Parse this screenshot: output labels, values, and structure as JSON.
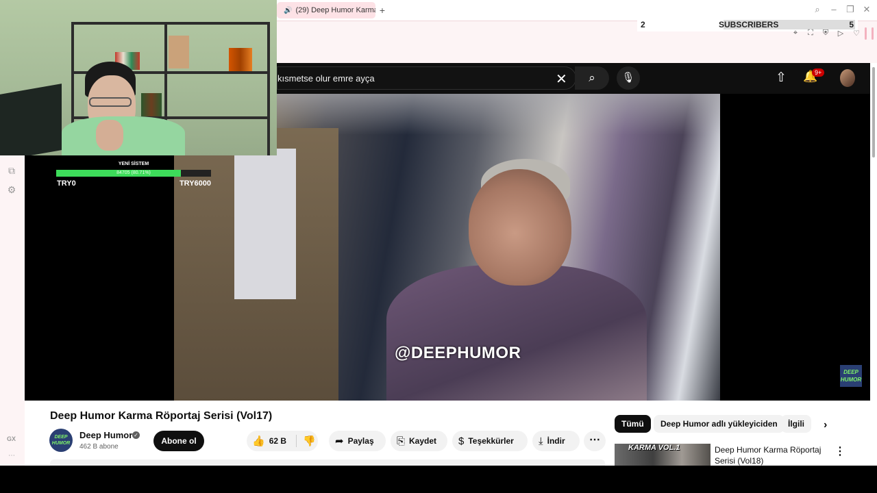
{
  "browser": {
    "tab_title": "(29) Deep Humor Karma",
    "new_tab": "+",
    "subscriber_widget": {
      "left": "2",
      "label": "SUBSCRIBERS",
      "right": "5"
    }
  },
  "goal_widget": {
    "title": "YENİ SİSTEM",
    "progress_text": "84705 (80.71%)",
    "progress_fraction": 0.8071,
    "min_label": "TRY0",
    "max_label": "TRY6000",
    "fill_color": "#3ddc5a"
  },
  "youtube": {
    "search_query": "kısmetse olur emre ayça",
    "notification_count": "9+",
    "video_watermark": "@DEEPHUMOR",
    "channel_watermark": "DEEP HUMOR",
    "video_title": "Deep Humor Karma Röportaj Serisi (Vol17)",
    "channel": {
      "name": "Deep Humor",
      "avatar_text": "DEEP HUMOR",
      "subscribers": "462 B abone",
      "subscribe_label": "Abone ol"
    },
    "actions": {
      "likes": "62 B",
      "share": "Paylaş",
      "save": "Kaydet",
      "thanks": "Teşekkürler",
      "download": "İndir",
      "more": "⋯"
    },
    "chips": [
      "Tümü",
      "Deep Humor adlı yükleyiciden",
      "İlgili"
    ],
    "next_video": {
      "thumb_text": "KARMA VOL.1",
      "title": "Deep Humor Karma Röportaj Serisi (Vol18)"
    },
    "accent_color": "#cc0000"
  },
  "sidebar": {
    "gx_label": "GX"
  }
}
